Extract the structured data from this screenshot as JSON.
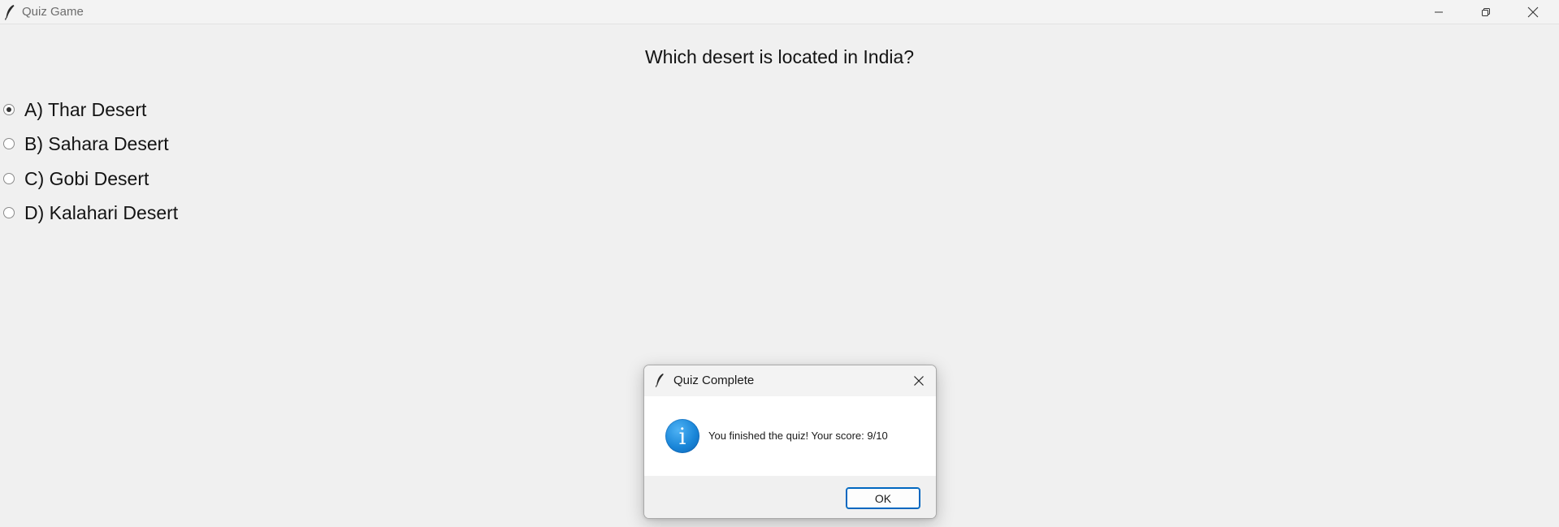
{
  "window": {
    "title": "Quiz Game",
    "controls": {
      "minimize": "minimize-icon",
      "maximize": "restore-icon",
      "close": "close-icon"
    }
  },
  "quiz": {
    "question": "Which desert is located in India?",
    "selected_index": 0,
    "options": [
      {
        "label": "A) Thar Desert",
        "selected": true
      },
      {
        "label": "B) Sahara Desert",
        "selected": false
      },
      {
        "label": "C) Gobi Desert",
        "selected": false
      },
      {
        "label": "D) Kalahari Desert",
        "selected": false
      }
    ]
  },
  "dialog": {
    "title": "Quiz Complete",
    "icon": "info-icon",
    "icon_glyph": "i",
    "message": "You finished the quiz! Your score: 9/10",
    "ok_label": "OK"
  },
  "colors": {
    "background": "#f0f0f0",
    "accent": "#0067c0",
    "info_icon": "#1a86d8"
  }
}
